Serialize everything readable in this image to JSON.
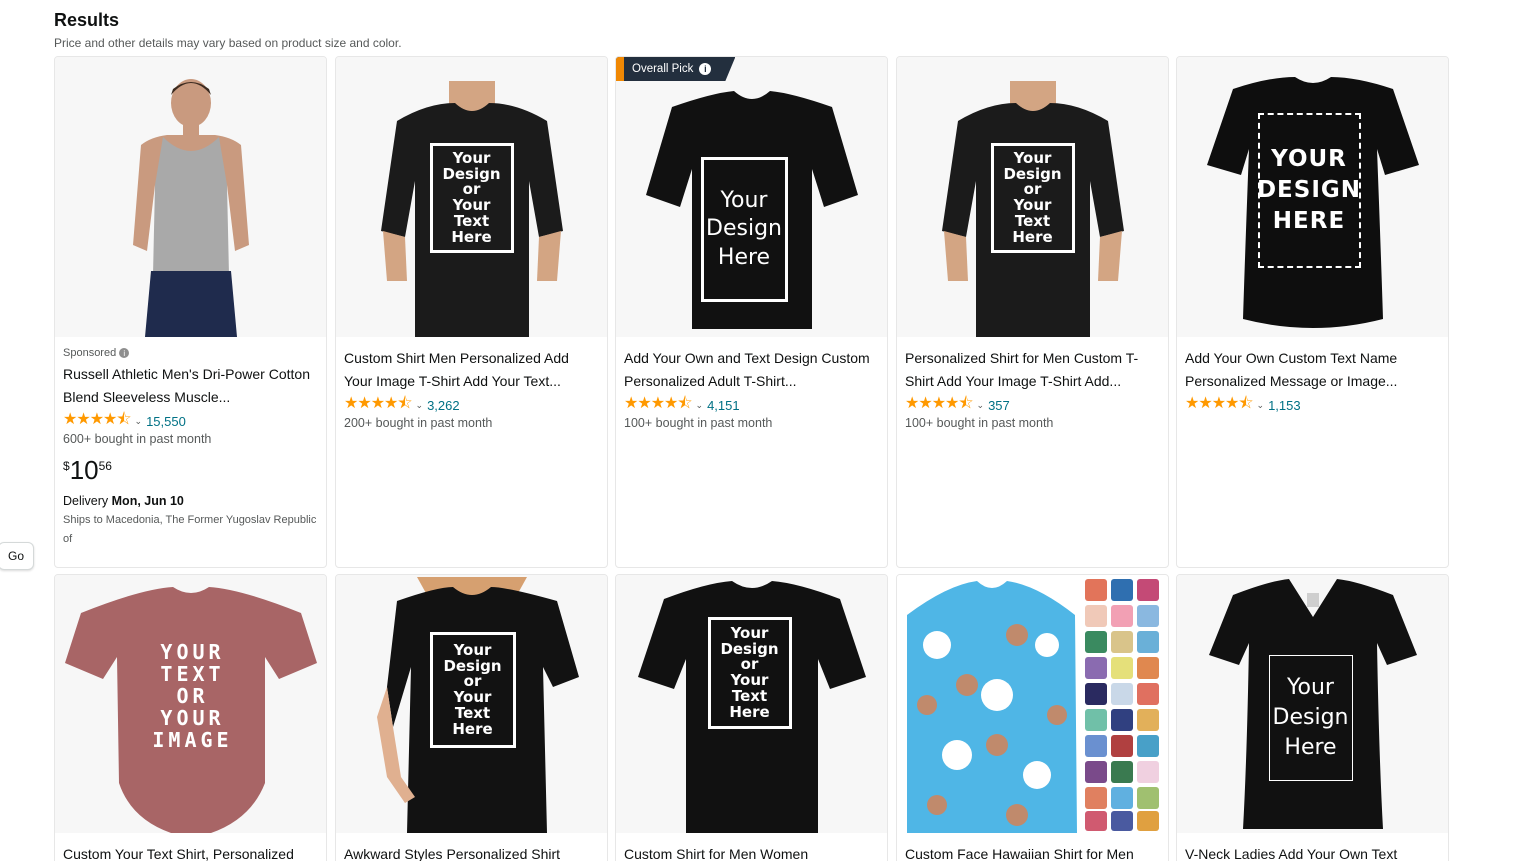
{
  "header": {
    "title": "Results",
    "subtitle": "Price and other details may vary based on product size and color."
  },
  "go_button": "Go",
  "badge": {
    "label": "Overall Pick",
    "icon": "info-icon"
  },
  "colors": {
    "star": "#ff9900",
    "link": "#007185",
    "badge_bg": "#232f3e",
    "badge_accent": "#f08804"
  },
  "products": [
    {
      "sponsored": "Sponsored",
      "title": "Russell Athletic Men's Dri-Power Cotton Blend Sleeveless Muscle...",
      "stars": "★★★★⯪",
      "rating_count": "15,550",
      "bought": "600+ bought in past month",
      "price": {
        "currency": "$",
        "whole": "10",
        "fraction": "56"
      },
      "delivery_label": "Delivery",
      "delivery_date": "Mon, Jun 10",
      "ships": "Ships to Macedonia, The Former Yugoslav Republic of"
    },
    {
      "title": "Custom Shirt Men Personalized Add Your Image T-Shirt Add Your Text...",
      "stars": "★★★★⯪",
      "rating_count": "3,262",
      "bought": "200+ bought in past month",
      "design_text": [
        "Your",
        "Design",
        "or",
        "Your",
        "Text",
        "Here"
      ]
    },
    {
      "title": "Add Your Own and Text Design Custom Personalized Adult T-Shirt...",
      "stars": "★★★★⯪",
      "rating_count": "4,151",
      "bought": "100+ bought in past month",
      "design_text": [
        "Your",
        "Design",
        "Here"
      ]
    },
    {
      "title": "Personalized Shirt for Men Custom T-Shirt Add Your Image T-Shirt Add...",
      "stars": "★★★★⯪",
      "rating_count": "357",
      "bought": "100+ bought in past month",
      "design_text": [
        "Your",
        "Design",
        "or",
        "Your",
        "Text",
        "Here"
      ]
    },
    {
      "title": "Add Your Own Custom Text Name Personalized Message or Image...",
      "stars": "★★★★⯪",
      "rating_count": "1,153",
      "design_text": [
        "YOUR",
        "DESIGN",
        "HERE"
      ]
    },
    {
      "title": "Custom Your Text Shirt, Personalized",
      "design_text": [
        "YOUR",
        "TEXT",
        "OR",
        "YOUR",
        "IMAGE"
      ]
    },
    {
      "title": "Awkward Styles Personalized Shirt",
      "design_text": [
        "Your",
        "Design",
        "or",
        "Your",
        "Text",
        "Here"
      ]
    },
    {
      "title": "Custom Shirt for Men Women",
      "design_text": [
        "Your",
        "Design",
        "or",
        "Your",
        "Text",
        "Here"
      ]
    },
    {
      "title": "Custom Face Hawaiian Shirt for Men"
    },
    {
      "title": "V-Neck Ladies Add Your Own Text",
      "design_text": [
        "Your",
        "Design",
        "Here"
      ]
    }
  ]
}
